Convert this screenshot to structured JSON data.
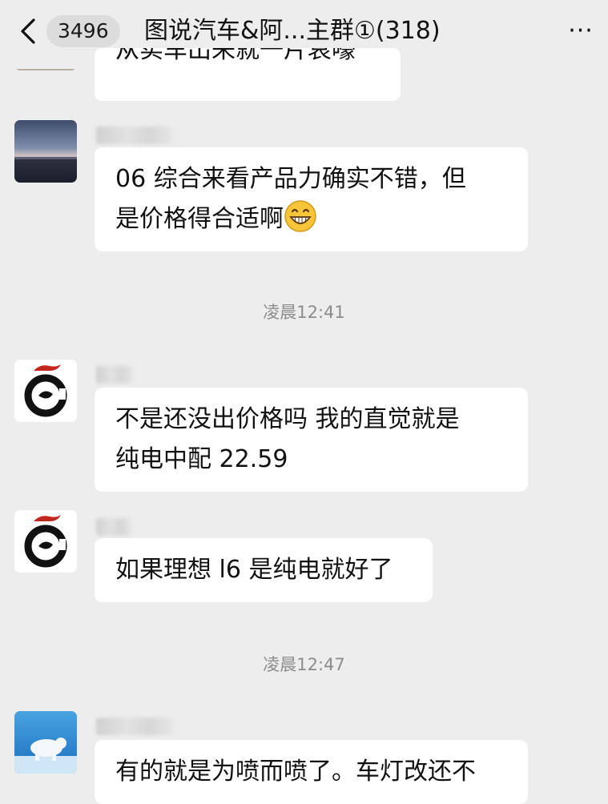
{
  "header": {
    "unread_count": "3496",
    "title": "图说汽车&阿...主群①(318)",
    "more_label": "···"
  },
  "messages": [
    {
      "text": "从实车出来就一片哀嚎"
    },
    {
      "text_line1": "06 综合来看产品力确实不错，但",
      "text_line2": "是价格得合适啊",
      "emoji": "grinning-face-emoji"
    },
    {
      "timestamp": "凌晨12:41"
    },
    {
      "text_line1": "不是还没出价格吗 我的直觉就是",
      "text_line2": "纯电中配 22.59"
    },
    {
      "text": "如果理想 l6 是纯电就好了"
    },
    {
      "timestamp": "凌晨12:47"
    },
    {
      "text": "有的就是为喷而喷了。车灯改还不"
    }
  ],
  "colors": {
    "background": "#ededed",
    "bubble": "#ffffff",
    "timestamp": "#8c8c8c"
  }
}
